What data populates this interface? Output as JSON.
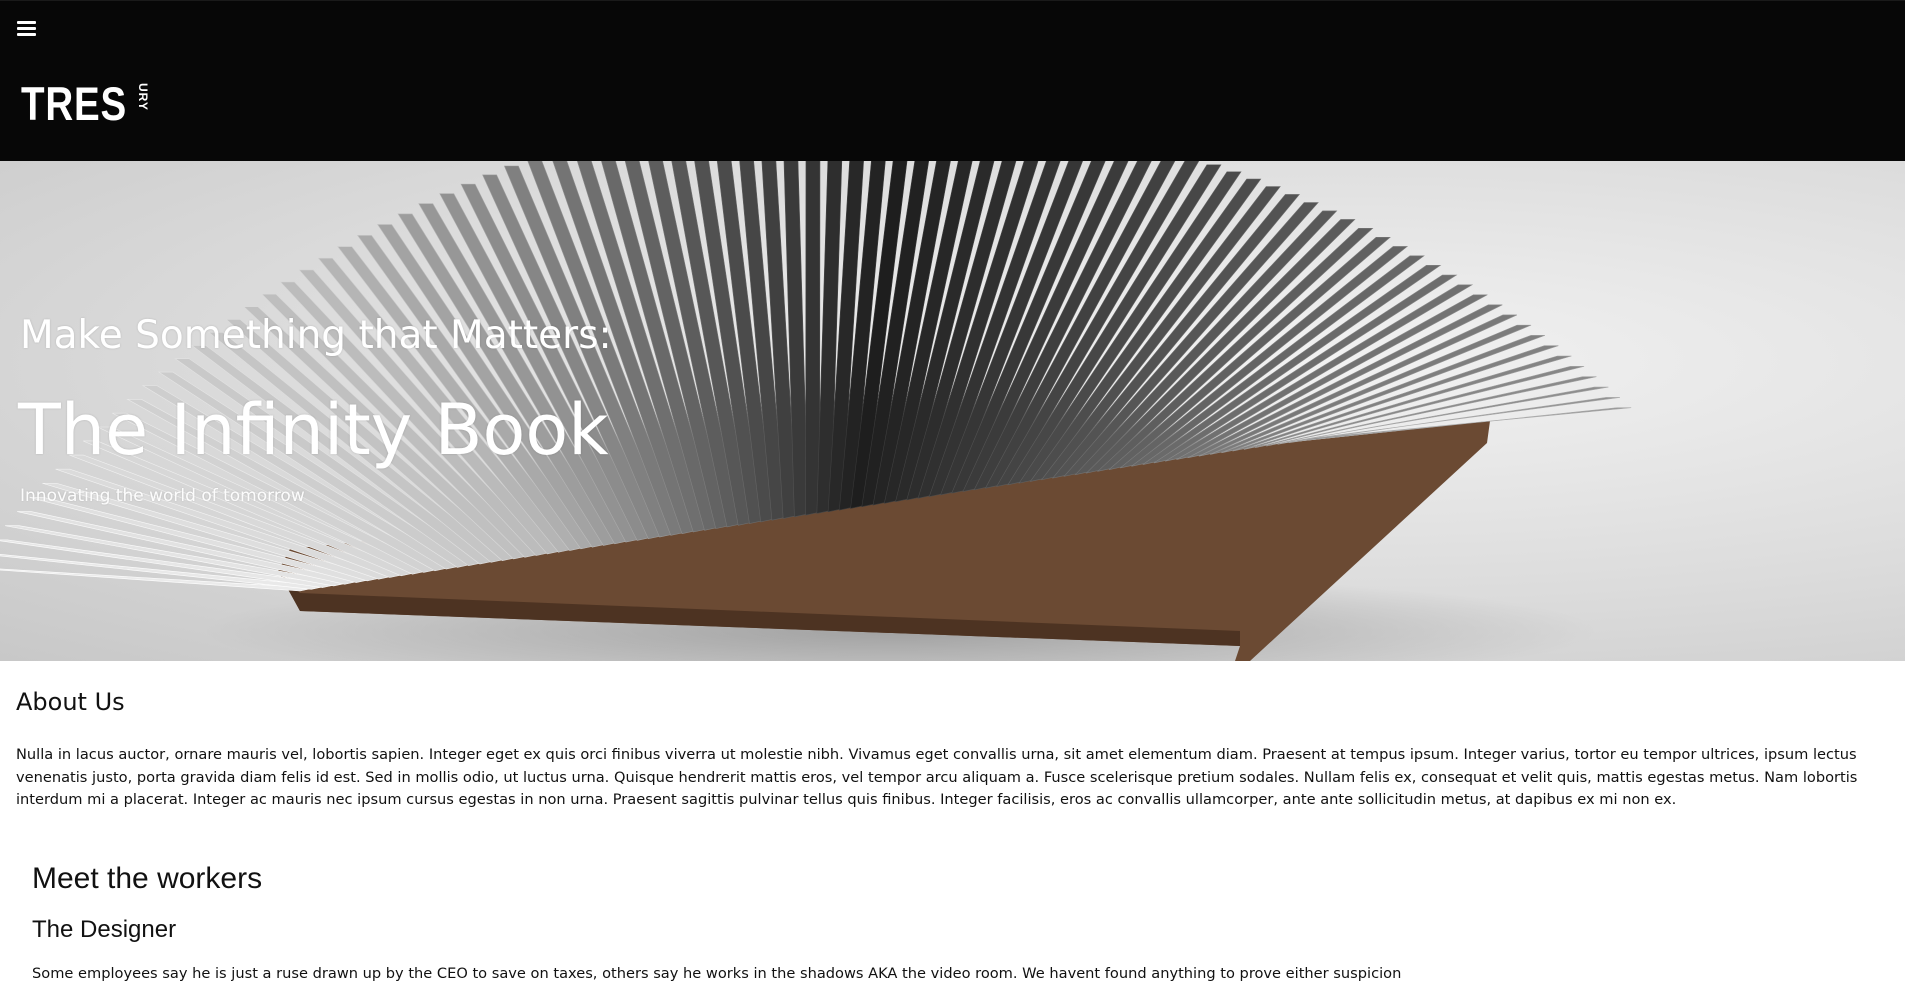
{
  "header": {
    "menu_icon": "hamburger-menu-icon",
    "logo_main": "TRES",
    "logo_side": "URY"
  },
  "hero": {
    "kicker": "Make Something that Matters:",
    "title": "The Infinity Book",
    "subtitle": "Innovating the world of tomorrow"
  },
  "about": {
    "title": "About Us",
    "body": "Nulla in lacus auctor, ornare mauris vel, lobortis sapien. Integer eget ex quis orci finibus viverra ut molestie nibh. Vivamus eget convallis urna, sit amet elementum diam. Praesent at tempus ipsum. Integer varius, tortor eu tempor ultrices, ipsum lectus venenatis justo, porta gravida diam felis id est. Sed in mollis odio, ut luctus urna. Quisque hendrerit mattis eros, vel tempor arcu aliquam a. Fusce scelerisque pretium sodales. Nullam felis ex, consequat et velit quis, mattis egestas metus. Nam lobortis interdum mi a placerat. Integer ac mauris nec ipsum cursus egestas in non urna. Praesent sagittis pulvinar tellus quis finibus. Integer facilisis, eros ac convallis ullamcorper, ante ante sollicitudin metus, at dapibus ex mi non ex."
  },
  "workers": {
    "title": "Meet the workers",
    "designer": {
      "title": "The Designer",
      "body": "Some employees say he is just a ruse drawn up by the CEO to save on taxes, others say he works in the shadows AKA the video room. We havent found anything to prove either suspicion"
    }
  },
  "colors": {
    "topbar": "#070707",
    "text": "#111111",
    "hero_text": "#ffffff",
    "book_wood": "#6b4a33"
  }
}
